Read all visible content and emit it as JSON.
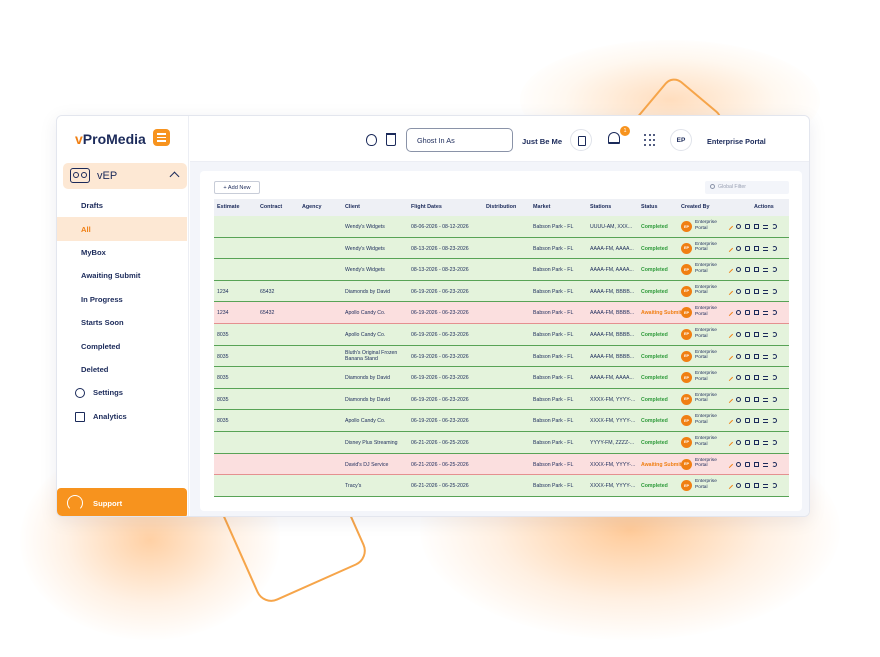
{
  "brand": {
    "name_prefix": "v",
    "name_rest": "ProMedia",
    "accent": "#f7931e"
  },
  "sidebar": {
    "group_label": "vEP",
    "items": [
      {
        "label": "Drafts",
        "active": false
      },
      {
        "label": "All",
        "active": true
      },
      {
        "label": "MyBox",
        "active": false
      },
      {
        "label": "Awaiting Submit",
        "active": false
      },
      {
        "label": "In Progress",
        "active": false
      },
      {
        "label": "Starts Soon",
        "active": false
      },
      {
        "label": "Completed",
        "active": false
      },
      {
        "label": "Deleted",
        "active": false
      },
      {
        "label": "Settings",
        "active": false,
        "icon": "gear-icon"
      },
      {
        "label": "Analytics",
        "active": false,
        "icon": "analytics-icon"
      }
    ],
    "support_label": "Support"
  },
  "header": {
    "ghost_input_value": "Ghost In As",
    "just_be_me": "Just Be Me",
    "notification_count": "1",
    "user_initials": "EP",
    "portal_name": "Enterprise Portal"
  },
  "toolbar": {
    "add_new": "+ Add New",
    "global_filter_placeholder": "Global Filter"
  },
  "table": {
    "columns": [
      "Estimate",
      "Contract",
      "Agency",
      "Client",
      "Flight Dates",
      "Distribution",
      "Market",
      "Stations",
      "Status",
      "Created By",
      "Actions"
    ],
    "rows": [
      {
        "estimate": "",
        "contract": "",
        "agency": "",
        "client": "Wendy's Widgets",
        "flight_dates": "08-06-2026 - 08-12-2026",
        "distribution": "",
        "market": "Babson Park - FL",
        "stations": "UUUU-AM, XXX...",
        "status": "Completed",
        "creator_initials": "EP",
        "created_by": "Enterprise Portal",
        "highlight": "green"
      },
      {
        "estimate": "",
        "contract": "",
        "agency": "",
        "client": "Wendy's Widgets",
        "flight_dates": "08-13-2026 - 08-23-2026",
        "distribution": "",
        "market": "Babson Park - FL",
        "stations": "AAAA-FM, AAAA...",
        "status": "Completed",
        "creator_initials": "EP",
        "created_by": "Enterprise Portal",
        "highlight": "green"
      },
      {
        "estimate": "",
        "contract": "",
        "agency": "",
        "client": "Wendy's Widgets",
        "flight_dates": "08-13-2026 - 08-23-2026",
        "distribution": "",
        "market": "Babson Park - FL",
        "stations": "AAAA-FM, AAAA...",
        "status": "Completed",
        "creator_initials": "EP",
        "created_by": "Enterprise Portal",
        "highlight": "green"
      },
      {
        "estimate": "1234",
        "contract": "65432",
        "agency": "",
        "client": "Diamonds by David",
        "flight_dates": "06-19-2026 - 06-23-2026",
        "distribution": "",
        "market": "Babson Park - FL",
        "stations": "AAAA-FM, BBBB...",
        "status": "Completed",
        "creator_initials": "EP",
        "created_by": "Enterprise Portal",
        "highlight": "green"
      },
      {
        "estimate": "1234",
        "contract": "65432",
        "agency": "",
        "client": "Apollo Candy Co.",
        "flight_dates": "06-19-2026 - 06-23-2026",
        "distribution": "",
        "market": "Babson Park - FL",
        "stations": "AAAA-FM, BBBB...",
        "status": "Awaiting Submit",
        "creator_initials": "EP",
        "created_by": "Enterprise Portal",
        "highlight": "red"
      },
      {
        "estimate": "8035",
        "contract": "",
        "agency": "",
        "client": "Apollo Candy Co.",
        "flight_dates": "06-19-2026 - 06-23-2026",
        "distribution": "",
        "market": "Babson Park - FL",
        "stations": "AAAA-FM, BBBB...",
        "status": "Completed",
        "creator_initials": "EP",
        "created_by": "Enterprise Portal",
        "highlight": "green"
      },
      {
        "estimate": "8035",
        "contract": "",
        "agency": "",
        "client": "Bluth's Original Frozen Banana Stand",
        "flight_dates": "06-19-2026 - 06-23-2026",
        "distribution": "",
        "market": "Babson Park - FL",
        "stations": "AAAA-FM, BBBB...",
        "status": "Completed",
        "creator_initials": "EP",
        "created_by": "Enterprise Portal",
        "highlight": "green"
      },
      {
        "estimate": "8035",
        "contract": "",
        "agency": "",
        "client": "Diamonds by David",
        "flight_dates": "06-19-2026 - 06-23-2026",
        "distribution": "",
        "market": "Babson Park - FL",
        "stations": "AAAA-FM, AAAA...",
        "status": "Completed",
        "creator_initials": "EP",
        "created_by": "Enterprise Portal",
        "highlight": "green"
      },
      {
        "estimate": "8035",
        "contract": "",
        "agency": "",
        "client": "Diamonds by David",
        "flight_dates": "06-19-2026 - 06-23-2026",
        "distribution": "",
        "market": "Babson Park - FL",
        "stations": "XXXX-FM, YYYY-...",
        "status": "Completed",
        "creator_initials": "EP",
        "created_by": "Enterprise Portal",
        "highlight": "green"
      },
      {
        "estimate": "8035",
        "contract": "",
        "agency": "",
        "client": "Apollo Candy Co.",
        "flight_dates": "06-19-2026 - 06-23-2026",
        "distribution": "",
        "market": "Babson Park - FL",
        "stations": "XXXX-FM, YYYY-...",
        "status": "Completed",
        "creator_initials": "EP",
        "created_by": "Enterprise Portal",
        "highlight": "green"
      },
      {
        "estimate": "",
        "contract": "",
        "agency": "",
        "client": "Disney Plus Streaming",
        "flight_dates": "06-21-2026 - 06-25-2026",
        "distribution": "",
        "market": "Babson Park - FL",
        "stations": "YYYY-FM, ZZZZ-...",
        "status": "Completed",
        "creator_initials": "EP",
        "created_by": "Enterprise Portal",
        "highlight": "green"
      },
      {
        "estimate": "",
        "contract": "",
        "agency": "",
        "client": "David's DJ Service",
        "flight_dates": "06-21-2026 - 06-25-2026",
        "distribution": "",
        "market": "Babson Park - FL",
        "stations": "XXXX-FM, YYYY-...",
        "status": "Awaiting Submit",
        "creator_initials": "EP",
        "created_by": "Enterprise Portal",
        "highlight": "red"
      },
      {
        "estimate": "",
        "contract": "",
        "agency": "",
        "client": "Tracy's",
        "flight_dates": "06-21-2026 - 06-25-2026",
        "distribution": "",
        "market": "Babson Park - FL",
        "stations": "XXXX-FM, YYYY-...",
        "status": "Completed",
        "creator_initials": "EP",
        "created_by": "Enterprise Portal",
        "highlight": "green"
      }
    ]
  }
}
